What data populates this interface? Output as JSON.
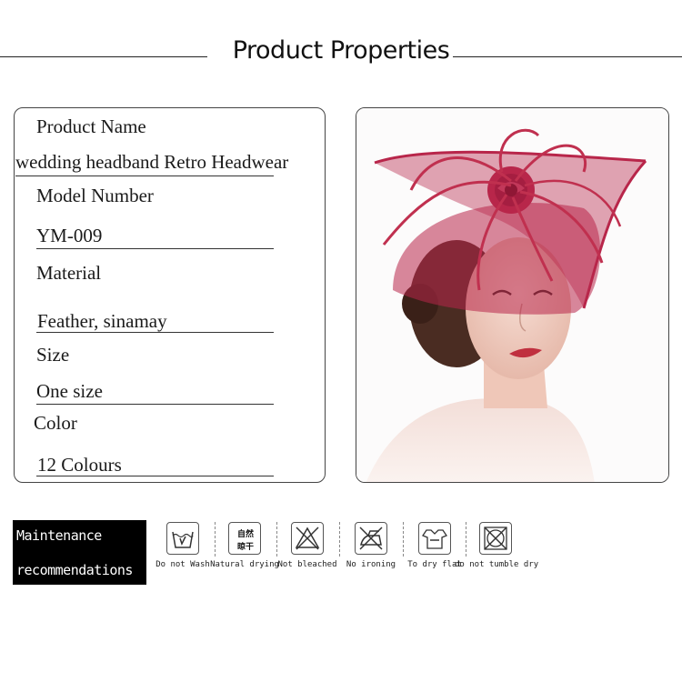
{
  "header": {
    "title": "Product Properties"
  },
  "properties": {
    "name_label": "Product Name",
    "name_value": "wedding headband Retro Headwear",
    "model_label": "Model Number",
    "model_value": "YM-009",
    "material_label": "Material",
    "material_value": "Feather, sinamay",
    "size_label": "Size",
    "size_value": "One size",
    "color_label": "Color",
    "color_value": "12 Colours"
  },
  "maintenance": {
    "line1": "Maintenance",
    "line2": "recommendations"
  },
  "care": [
    {
      "label": "Do not Wash",
      "icon": "no-wash-icon"
    },
    {
      "label": "Natural drying",
      "icon": "natural-drying-icon",
      "symbol_top": "自然",
      "symbol_bottom": "晾干"
    },
    {
      "label": "Not bleached",
      "icon": "no-bleach-icon"
    },
    {
      "label": "No ironing",
      "icon": "no-iron-icon"
    },
    {
      "label": "To dry flat",
      "icon": "dry-flat-icon"
    },
    {
      "label": "do not tumble dry",
      "icon": "no-tumble-dry-icon"
    }
  ],
  "colors": {
    "fascinator": "#b8264a",
    "accent": "#000000"
  }
}
